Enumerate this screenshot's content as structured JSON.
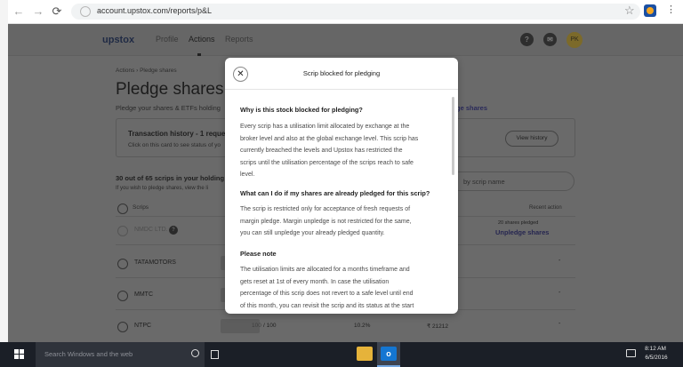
{
  "browser": {
    "url": "account.upstox.com/reports/p&L"
  },
  "nav": {
    "logo": "upstox",
    "links": [
      "Profile",
      "Actions",
      "Reports"
    ],
    "help_icon_glyph": "?",
    "avatar_initials": "PK"
  },
  "page": {
    "breadcrumb": "Actions  ›  Pledge shares",
    "title": "Pledge shares",
    "subtitle": "Pledge your shares & ETFs holding",
    "pledge_link": "ge shares",
    "transaction_card": {
      "title": "Transaction history - 1 request",
      "subtitle": "Click on this card to see status of yo",
      "button": "View history"
    },
    "scrips_count": "30 out of 65 scrips in your holding",
    "scrips_note": "If you wish to pledge shares, view the li",
    "search_placeholder": "by scrip name",
    "table_header": {
      "scrips": "Scrips",
      "recent_action": "Recent action"
    },
    "rows": [
      {
        "name": "NMDC LTD.",
        "pledged_note": "20 shares pledged",
        "action": "Unpledge shares"
      },
      {
        "name": "TATAMOTORS",
        "dash": "-"
      },
      {
        "name": "MMTC",
        "dash": "-"
      },
      {
        "name": "NTPC",
        "qty": "100",
        "qty_max": "/ 100",
        "pct": "10.2%",
        "amount": "₹ 21212",
        "dash": "-"
      }
    ]
  },
  "modal": {
    "title": "Scrip blocked for pledging",
    "sections": [
      {
        "heading": "Why is this stock blocked for pledging?",
        "lines": [
          "Every scrip has a utilisation limit allocated by exchange at the",
          "broker level and also at the global exchange level. This scrip has",
          "currently breached the levels and Upstox has restricted the",
          "scrips until the utilisation percentage of the scrips reach to safe",
          "level."
        ]
      },
      {
        "heading": "What can I do if my shares are already pledged for this scrip?",
        "lines": [
          "The scrip is restricted only for acceptance of fresh requests of",
          "margin pledge. Margin unpledge is not restricted for the same,",
          "you can still unpledge your already pledged quantity."
        ]
      },
      {
        "heading": "Please note",
        "lines": [
          "The utilisation limits are allocated for a months timeframe and",
          "gets reset at 1st of every month. In case the utilisation",
          "percentage of this scrip does not revert to a safe level until end",
          "of this month, you can revisit the scrip and its status at the start"
        ]
      }
    ]
  },
  "taskbar": {
    "search_placeholder": "Search Windows and the web",
    "time": "8:12 AM",
    "date": "6/5/2016",
    "outlook_glyph": "o"
  }
}
